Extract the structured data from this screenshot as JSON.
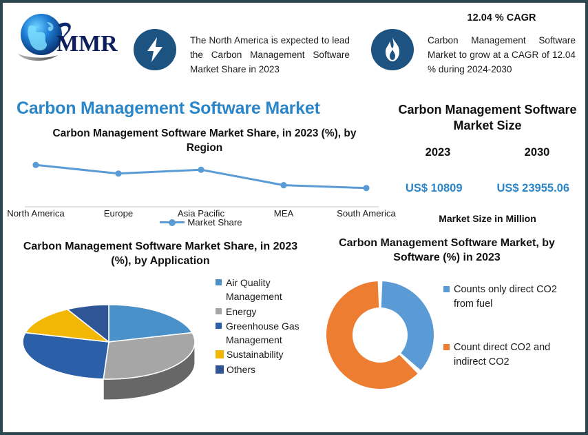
{
  "border_color": "#2c4650",
  "accent_blue": "#2a86c8",
  "badge_color": "#1c5380",
  "logo": {
    "name": "MMR",
    "text": "MMR"
  },
  "header": {
    "bolt_note": "The North America is expected to lead the Carbon Management Software Market Share in 2023",
    "cagr_headline": "12.04 % CAGR",
    "cagr_note": "Carbon Management Software Market to grow at a CAGR of 12.04 % during 2024-2030"
  },
  "main_title": "Carbon Management Software Market",
  "market_size": {
    "title": "Carbon Management Software Market Size",
    "year_left": "2023",
    "year_right": "2030",
    "value_left": "US$ 10809",
    "value_right": "US$ 23955.06",
    "footnote": "Market Size in Million"
  },
  "chart_data": [
    {
      "type": "line",
      "title": "Carbon Management Software Market Share, in 2023 (%), by Region",
      "xlabel": "",
      "ylabel": "",
      "categories": [
        "North America",
        "Europe",
        "Asia Pacific",
        "MEA",
        "South America"
      ],
      "series": [
        {
          "name": "Market Share",
          "values": [
            37,
            28,
            32,
            16,
            13
          ],
          "color": "#5b9bd5"
        }
      ],
      "ylim": [
        0,
        40
      ],
      "grid": false,
      "legend_position": "bottom",
      "legend_entries": [
        "Market Share"
      ]
    },
    {
      "type": "pie",
      "title": "Carbon Management Software Market Share, in 2023 (%), by Application",
      "three_d": true,
      "categories": [
        "Air Quality Management",
        "Energy",
        "Greenhouse Gas Management",
        "Sustainability",
        "Others"
      ],
      "values": [
        21,
        30,
        28,
        13,
        8
      ],
      "colors": [
        "#4a90c9",
        "#a6a6a6",
        "#2b5fa8",
        "#f2b705",
        "#2f5597"
      ],
      "legend_position": "right"
    },
    {
      "type": "pie",
      "subtype": "donut",
      "title": "Carbon Management Software Market, by Software (%) in 2023",
      "categories": [
        "Counts only direct CO2 from fuel",
        "Count direct CO2 and indirect CO2"
      ],
      "values": [
        37,
        63
      ],
      "colors": [
        "#5b9bd5",
        "#ed7d31"
      ],
      "legend_position": "right"
    }
  ]
}
